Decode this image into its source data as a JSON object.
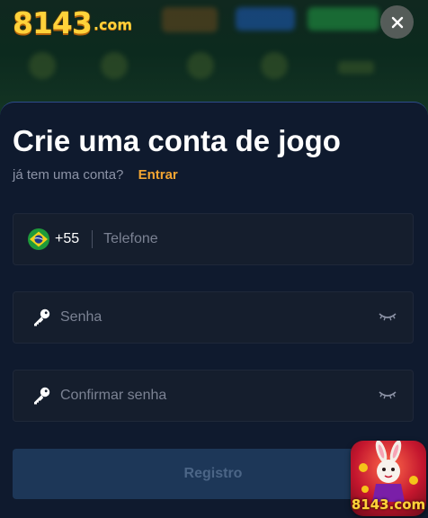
{
  "header": {
    "logo_number": "8143",
    "logo_suffix": ".com",
    "close_glyph": "✕"
  },
  "register": {
    "title": "Crie uma conta de jogo",
    "subtitle": "já tem uma conta?",
    "login_link": "Entrar",
    "phone": {
      "country_code": "+55",
      "placeholder": "Telefone",
      "flag_icon": "brazil-flag-icon"
    },
    "password": {
      "placeholder": "Senha",
      "icon": "key-icon",
      "toggle_icon": "eye-closed-icon"
    },
    "confirm_password": {
      "placeholder": "Confirmar senha",
      "icon": "key-icon",
      "toggle_icon": "eye-closed-icon"
    },
    "submit_label": "Registro"
  },
  "promo": {
    "label": "8143.com"
  },
  "colors": {
    "accent_link": "#f3a532",
    "modal_bg": "#0f1a2e",
    "field_bg": "#151e2d",
    "button_bg": "#1d3758",
    "button_text": "#4b6586",
    "logo_gold": "#ffd23a"
  }
}
